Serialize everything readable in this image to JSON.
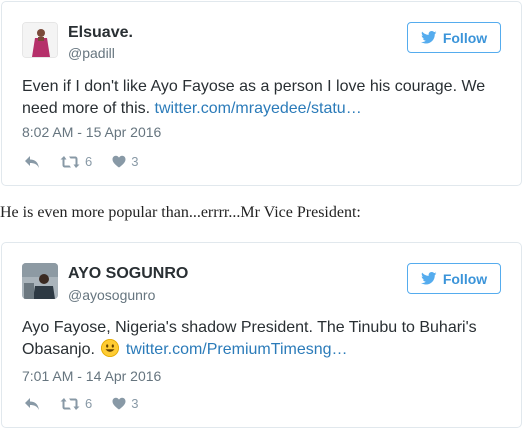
{
  "tweets": [
    {
      "name": "Elsuave.",
      "handle": "@padill",
      "follow_label": "Follow",
      "text": "Even if I don't like Ayo Fayose as a person I love his courage. We need more of this. ",
      "link": "twitter.com/mrayedee/statu…",
      "timestamp": "8:02 AM - 15 Apr 2016",
      "retweets": "6",
      "likes": "3"
    },
    {
      "name": "AYO SOGUNRO",
      "handle": "@ayosogunro",
      "follow_label": "Follow",
      "text": "Ayo Fayose, Nigeria's shadow President. The Tinubu to Buhari's Obasanjo. ",
      "link": "twitter.com/PremiumTimesng…",
      "timestamp": "7:01 AM - 14 Apr 2016",
      "retweets": "6",
      "likes": "3"
    }
  ],
  "between_text": "He is even more popular than...errrr...Mr Vice President:",
  "icons": [
    "twitter-bird-icon",
    "reply-icon",
    "retweet-icon",
    "heart-icon",
    "smiley-emoji-icon"
  ],
  "colors": {
    "link": "#2b7bb9",
    "follow_border": "#55acee",
    "follow_text": "#3b94d9",
    "muted": "#66757f",
    "action": "#8899a6"
  }
}
